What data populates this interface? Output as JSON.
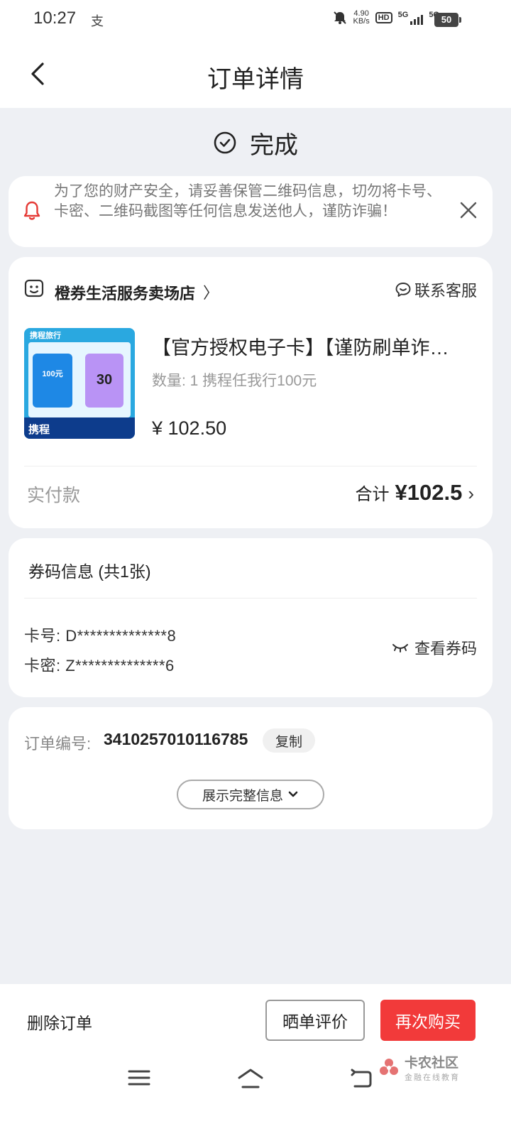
{
  "status_bar": {
    "time": "10:27",
    "app_glyph": "支",
    "net_speed_value": "4.90",
    "net_speed_unit": "KB/s",
    "hd_label": "HD",
    "sim1_label": "5G",
    "sim2_label": "5G",
    "battery": "50"
  },
  "header": {
    "title": "订单详情"
  },
  "order_status": {
    "label": "完成"
  },
  "notice": {
    "text": "为了您的财产安全，请妥善保管二维码信息，切勿将卡号、卡密、二维码截图等任何信息发送他人，谨防诈骗！"
  },
  "shop": {
    "name": "橙券生活服务卖场店",
    "chevron": "〉",
    "contact_label": "联系客服"
  },
  "product": {
    "title": "【官方授权电子卡】【谨防刷单诈骗】",
    "quantity": "数量: 1 携程任我行100元",
    "price": "¥ 102.50",
    "thumb_brand": "携程旅行",
    "thumb_left": "100元",
    "thumb_right": "30",
    "thumb_bottom": "携程"
  },
  "payment": {
    "label": "实付款",
    "total_label": "合计",
    "total_amount": "¥102.5",
    "chevron": "›"
  },
  "voucher": {
    "title": "券码信息  (共1张)",
    "card_no": "卡号:  D**************8",
    "card_pwd": "卡密:  Z**************6",
    "view_label": "查看券码"
  },
  "order_info": {
    "label": "订单编号:",
    "number": "3410257010116785",
    "copy_label": "复制",
    "expand_label": "展示完整信息"
  },
  "bottom": {
    "delete_label": "删除订单",
    "review_label": "晒单评价",
    "buy_again_label": "再次购买"
  },
  "watermark": {
    "title": "卡农社区",
    "subtitle": "金融在线教育"
  },
  "colors": {
    "accent_red": "#f23a3a",
    "bell_red": "#e53935"
  }
}
